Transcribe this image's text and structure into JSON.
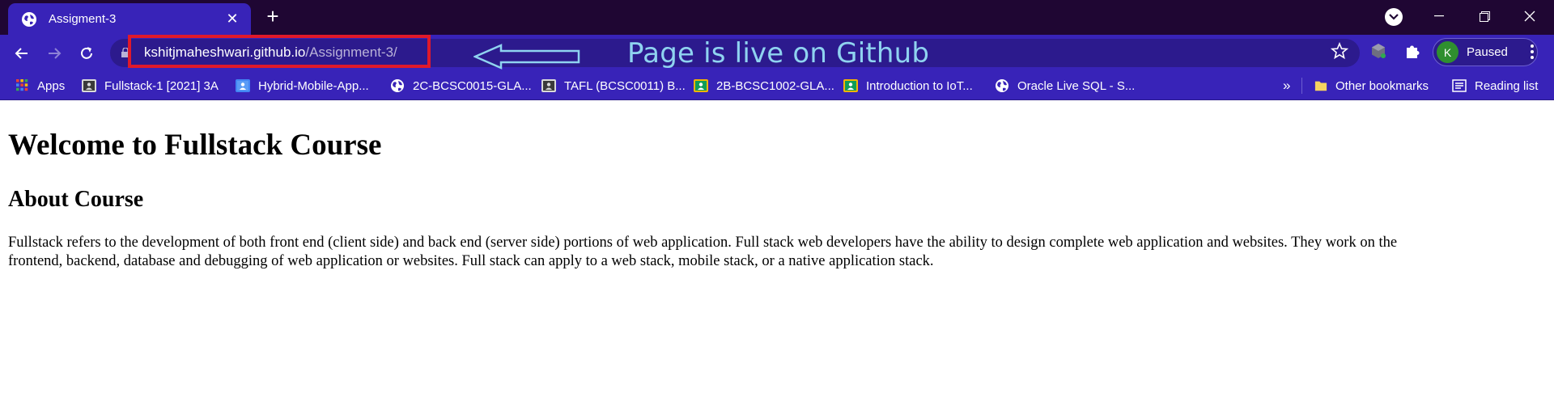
{
  "window": {
    "tab_title": "Assigment-3",
    "tab_close": "✕",
    "new_tab": "+",
    "controls": {
      "minimize": "—",
      "restore": "❐",
      "close": "✕"
    }
  },
  "toolbar": {
    "url_host": "kshitjmaheshwari.github.io",
    "url_path": "/Assignment-3/",
    "annotation": "Page is live on Github",
    "profile_initial": "K",
    "profile_status": "Paused"
  },
  "bookmarks": {
    "apps": "Apps",
    "items": [
      {
        "label": "Fullstack-1 [2021] 3A",
        "icon": "classroom-icon"
      },
      {
        "label": "Hybrid-Mobile-App...",
        "icon": "classroom-icon"
      },
      {
        "label": "2C-BCSC0015-GLA...",
        "icon": "globe-icon"
      },
      {
        "label": "TAFL (BCSC0011) B...",
        "icon": "classroom-icon"
      },
      {
        "label": "2B-BCSC1002-GLA...",
        "icon": "classroom-icon"
      },
      {
        "label": "Introduction to IoT...",
        "icon": "classroom-icon"
      },
      {
        "label": "Oracle Live SQL - S...",
        "icon": "globe-icon"
      }
    ],
    "more": "»",
    "other": "Other bookmarks",
    "reading_list": "Reading list"
  },
  "page": {
    "heading": "Welcome to Fullstack Course",
    "subheading": "About Course",
    "line1": "Fullstack refers to the development of both front end (client side) and back end (server side) portions of web application. Full stack web developers have the ability to design complete web application and websites. They work on the",
    "line2": "frontend, backend, database and debugging of web application or websites. Full stack can apply to a web stack, mobile stack, or a native application stack."
  },
  "colors": {
    "titlebar": "#1f0633",
    "toolbar": "#3823b8",
    "omnibox": "#2c1a8d",
    "highlight": "#e0192a",
    "annotation": "#8fd3f0"
  }
}
